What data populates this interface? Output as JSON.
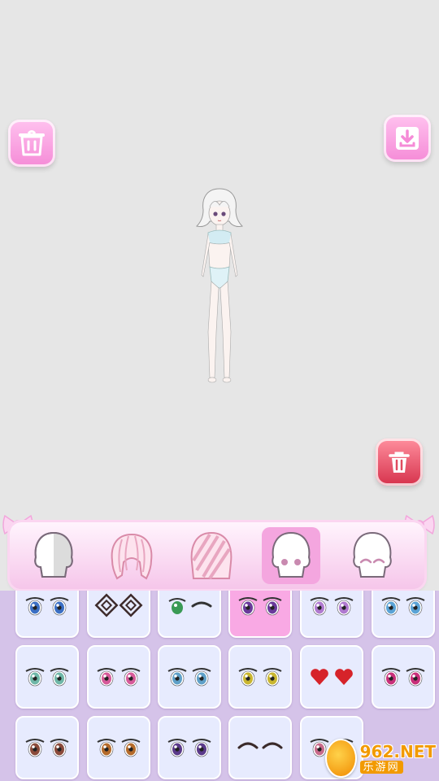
{
  "toolbar": {
    "clothes_icon": "outfit-hanger-icon",
    "download_icon": "download-icon",
    "delete_icon": "trash-icon"
  },
  "tabs": [
    {
      "name": "skin",
      "icon": "skin-tone-icon",
      "active": false
    },
    {
      "name": "back-hair",
      "icon": "back-hair-icon",
      "active": false
    },
    {
      "name": "front-hair",
      "icon": "front-hair-icon",
      "active": false
    },
    {
      "name": "eyes",
      "icon": "face-eyes-icon",
      "active": true
    },
    {
      "name": "expression",
      "icon": "face-expression-icon",
      "active": false
    }
  ],
  "eye_options": [
    {
      "style": "blue-eyes",
      "color": "#3b6fc4",
      "selected": false
    },
    {
      "style": "spiral-eyes",
      "color": "#3d2a2a",
      "selected": false
    },
    {
      "style": "green-wink",
      "color": "#3a9a55",
      "selected": false
    },
    {
      "style": "purple-eyes",
      "color": "#6a3a9c",
      "selected": true
    },
    {
      "style": "lilac-eyes",
      "color": "#b07ad0",
      "selected": false
    },
    {
      "style": "sky-eyes",
      "color": "#5aa3d6",
      "selected": false
    },
    {
      "style": "mint-eyes",
      "color": "#6fb7a8",
      "selected": false
    },
    {
      "style": "pink-sparkle-eyes",
      "color": "#d65a9a",
      "selected": false
    },
    {
      "style": "teal-blue-eyes",
      "color": "#5fa0c8",
      "selected": false
    },
    {
      "style": "yellow-black-eyes",
      "color": "#c9b630",
      "selected": false
    },
    {
      "style": "heart-eyes",
      "color": "#d6232a",
      "selected": false
    },
    {
      "style": "magenta-eyes",
      "color": "#c8307a",
      "selected": false
    },
    {
      "style": "brown-eyes",
      "color": "#8a4a3a",
      "selected": false
    },
    {
      "style": "amber-eyes",
      "color": "#b46a2a",
      "selected": false
    },
    {
      "style": "violet-eyes",
      "color": "#5a3a8a",
      "selected": false
    },
    {
      "style": "closed-eyes",
      "color": "#3a2a2a",
      "selected": false
    },
    {
      "style": "rose-eyes",
      "color": "#c86a8a",
      "selected": false
    }
  ],
  "watermark": {
    "main": "962.NET",
    "sub": "乐游网"
  }
}
